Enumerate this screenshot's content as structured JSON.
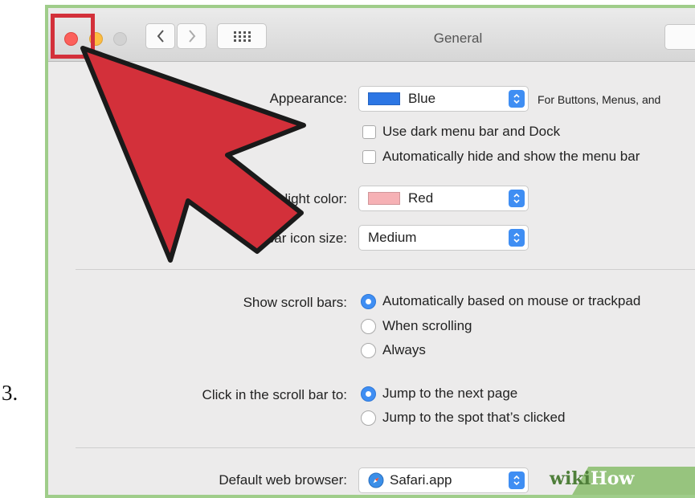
{
  "step": {
    "number": "3."
  },
  "window": {
    "title": "General",
    "traffic_lights": {
      "close": "#fc605b",
      "minimize": "#fdbc40",
      "zoom": "#d2d2d2"
    },
    "icons": {
      "back": "chevron-left-icon",
      "forward": "chevron-right-icon",
      "show_all": "grid-icon"
    }
  },
  "appearance": {
    "label": "Appearance:",
    "value": "Blue",
    "swatch_color": "#2c76e4",
    "hint": "For Buttons, Menus, and",
    "checkbox_dark_menu": "Use dark menu bar and Dock",
    "checkbox_auto_hide": "Automatically hide and show the menu bar"
  },
  "highlight_color": {
    "label": "Highlight color:",
    "value": "Red",
    "swatch_color": "#f6b1b5"
  },
  "sidebar_icon_size": {
    "label": "Sidebar icon size:",
    "value": "Medium"
  },
  "scroll_bars": {
    "label": "Show scroll bars:",
    "options": [
      {
        "label": "Automatically based on mouse or trackpad",
        "selected": true
      },
      {
        "label": "When scrolling",
        "selected": false
      },
      {
        "label": "Always",
        "selected": false
      }
    ]
  },
  "click_scroll_bar": {
    "label": "Click in the scroll bar to:",
    "options": [
      {
        "label": "Jump to the next page",
        "selected": true
      },
      {
        "label": "Jump to the spot that’s clicked",
        "selected": false
      }
    ]
  },
  "default_browser": {
    "label": "Default web browser:",
    "value": "Safari.app"
  },
  "watermark": {
    "part1": "wiki",
    "part2": "How"
  },
  "colors": {
    "accent": "#3f8ef3",
    "annotation_red": "#d3303a",
    "frame_green": "#9fcd8a"
  }
}
